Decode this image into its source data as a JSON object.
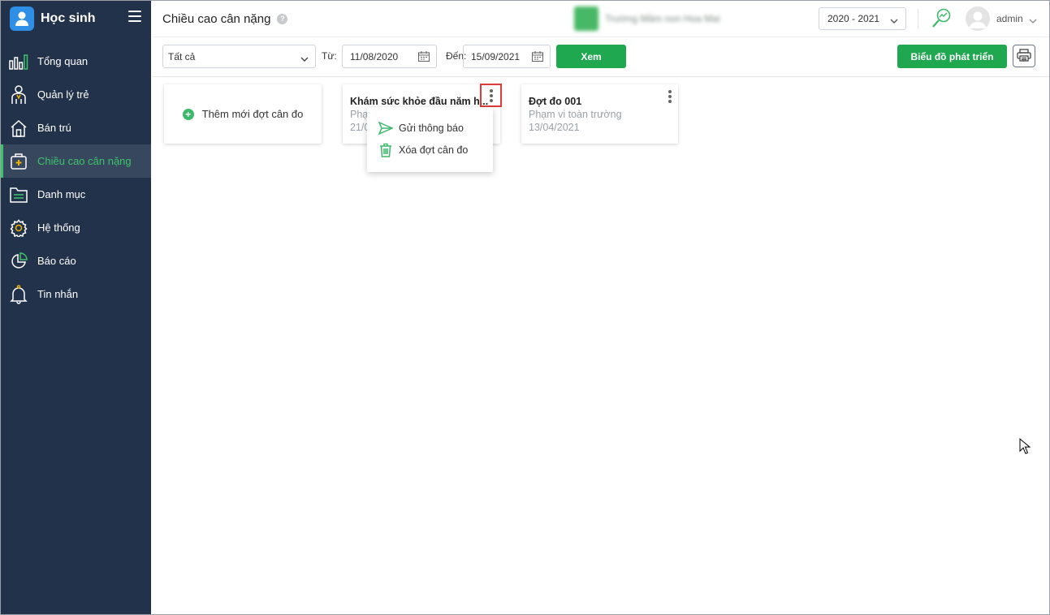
{
  "colors": {
    "sidebar": "#22324a",
    "accent": "#3cc46a",
    "button": "#1fa850",
    "brand_logo": "#2f8fe6"
  },
  "app": {
    "title": "Học sinh"
  },
  "sidebar": {
    "items": [
      {
        "label": "Tổng quan",
        "icon": "bar-chart-icon"
      },
      {
        "label": "Quản lý trẻ",
        "icon": "child-icon"
      },
      {
        "label": "Bán trú",
        "icon": "home-icon"
      },
      {
        "label": "Chiều cao cân nặng",
        "icon": "medical-kit-icon",
        "active": true
      },
      {
        "label": "Danh mục",
        "icon": "folder-icon"
      },
      {
        "label": "Hệ thống",
        "icon": "gear-icon"
      },
      {
        "label": "Báo cáo",
        "icon": "pie-chart-icon"
      },
      {
        "label": "Tin nhắn",
        "icon": "bell-icon"
      }
    ]
  },
  "header": {
    "page_title": "Chiều cao cân nặng",
    "help": "?",
    "school_name": "Trường Mầm non Hoa Mai",
    "school_year": "2020 - 2021",
    "user": "admin"
  },
  "toolbar": {
    "filter_value": "Tất cả",
    "from_label": "Từ:",
    "from_date": "11/08/2020",
    "to_label": "Đến:",
    "to_date": "15/09/2021",
    "view_button": "Xem",
    "growth_chart_button": "Biểu đồ phát triển"
  },
  "cards": {
    "add_label": "Thêm mới đợt cân đo",
    "items": [
      {
        "title": "Khám sức khỏe đầu năm h...",
        "scope": "Phạm vi toàn trường",
        "date": "21/09/2020"
      },
      {
        "title": "Đợt đo 001",
        "scope": "Phạm vi toàn trường",
        "date": "13/04/2021"
      }
    ]
  },
  "menu": {
    "items": [
      {
        "label": "Gửi thông báo",
        "icon": "send-icon"
      },
      {
        "label": "Xóa đợt cân đo",
        "icon": "trash-icon"
      }
    ]
  }
}
